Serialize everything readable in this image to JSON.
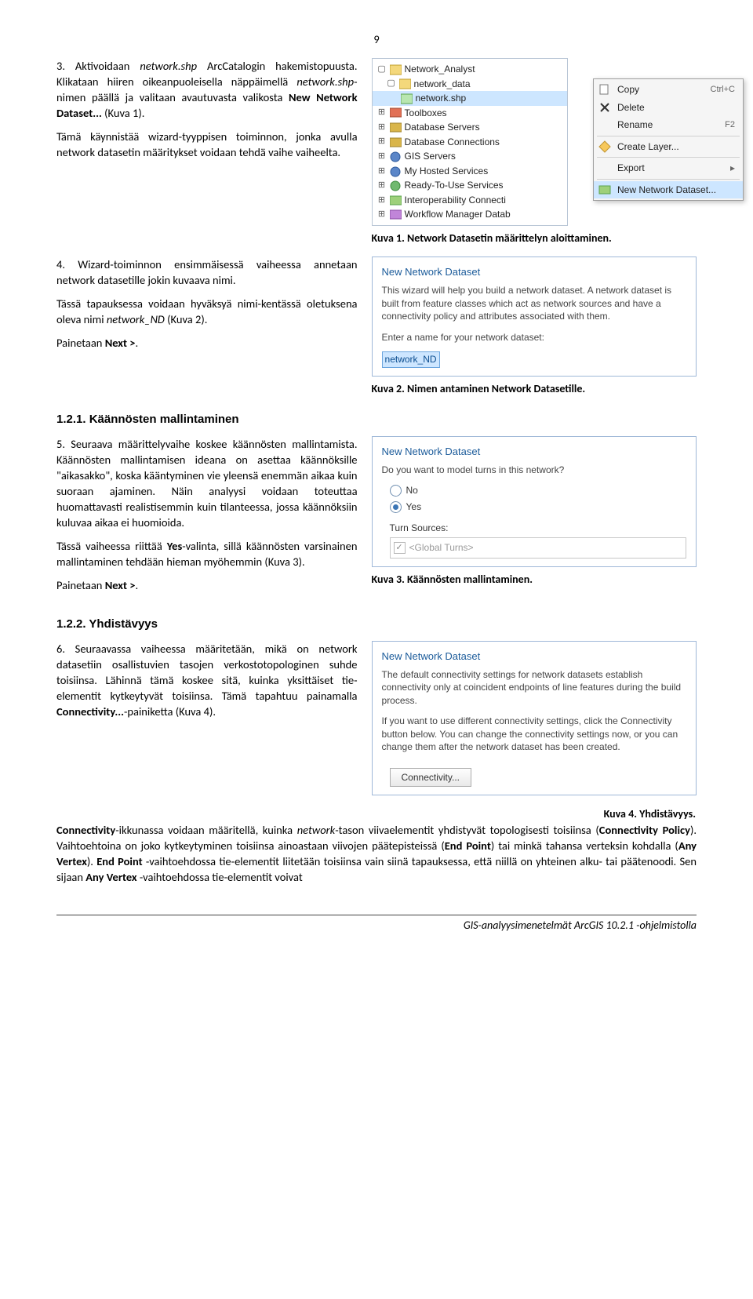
{
  "page_number": "9",
  "section1": {
    "p1_pre": "3. Aktivoidaan ",
    "p1_i": "network.shp",
    "p1_mid1": " ArcCatalogin hakemistopuusta. Klikataan hiiren oikeanpuoleisella näppäimellä ",
    "p1_i2": "network.shp",
    "p1_mid2": "-nimen päällä ja valitaan avautuvasta valikosta ",
    "p1_b": "New Network Dataset...",
    "p1_post": " (Kuva 1).",
    "p2": "Tämä käynnistää wizard-tyyppisen toiminnon, jonka avulla network datasetin määritykset voidaan tehdä vaihe vaiheelta.",
    "caption": "Kuva 1. Network Datasetin määrittelyn aloittaminen."
  },
  "fig1": {
    "tree": [
      "Network_Analyst",
      "network_data",
      "network.shp",
      "Toolboxes",
      "Database Servers",
      "Database Connections",
      "GIS Servers",
      "My Hosted Services",
      "Ready-To-Use Services",
      "Interoperability Connecti",
      "Workflow Manager Datab"
    ],
    "menu_copy": "Copy",
    "kb_copy": "Ctrl+C",
    "menu_delete": "Delete",
    "menu_rename": "Rename",
    "kb_rename": "F2",
    "menu_create": "Create Layer...",
    "menu_export": "Export",
    "menu_nnd": "New Network Dataset..."
  },
  "section2": {
    "p1": "4. Wizard-toiminnon ensimmäisessä vaiheessa annetaan network datasetille jokin kuvaava nimi.",
    "p2_pre": "Tässä tapauksessa voidaan hyväksyä nimi-kentässä oletuksena oleva nimi ",
    "p2_i": "network_ND",
    "p2_post": " (Kuva 2).",
    "p3_pre": "Painetaan ",
    "p3_b": "Next >",
    "p3_post": ".",
    "caption": "Kuva 2. Nimen antaminen Network Datasetille."
  },
  "fig2": {
    "title": "New Network Dataset",
    "txt": "This wizard will help you build a network dataset. A network dataset is built from feature classes which act as network sources and have a connectivity policy and attributes associated with them.",
    "label": "Enter a name for your network dataset:",
    "value": "network_ND"
  },
  "h121": "1.2.1. Käännösten mallintaminen",
  "section3": {
    "p1": "5. Seuraava määrittelyvaihe koskee käännösten mallintamista. Käännösten mallintamisen ideana on asettaa käännöksille \"aikasakko\", koska kääntyminen vie yleensä enemmän aikaa kuin suoraan ajaminen. Näin analyysi voidaan toteuttaa huomattavasti realistisemmin kuin tilanteessa, jossa käännöksiin kuluvaa aikaa ei huomioida.",
    "p2_pre": "Tässä vaiheessa riittää ",
    "p2_b": "Yes",
    "p2_post": "-valinta, sillä käännösten varsinainen mallintaminen tehdään hieman myöhemmin (Kuva 3).",
    "p3_pre": "Painetaan ",
    "p3_b": "Next >",
    "p3_post": ".",
    "caption": "Kuva 3. Käännösten mallintaminen."
  },
  "fig3": {
    "title": "New Network Dataset",
    "txt": "Do you want to model turns in this network?",
    "no": "No",
    "yes": "Yes",
    "tslabel": "Turn Sources:",
    "gt": "<Global Turns>"
  },
  "h122": "1.2.2. Yhdistävyys",
  "section4": {
    "p1_pre": "6. Seuraavassa vaiheessa määritetään, mikä on network datasetiin osallistuvien tasojen verkostotopologinen suhde toisiinsa. Lähinnä tämä koskee sitä, kuinka yksittäiset tie-elementit kytkeytyvät toisiinsa. Tämä tapahtuu painamalla ",
    "p1_b": "Connectivity...",
    "p1_post": "-painiketta (Kuva 4).",
    "caption": "Kuva 4. Yhdistävyys."
  },
  "fig4": {
    "title": "New Network Dataset",
    "txt1": "The default connectivity settings for network datasets establish connectivity only at coincident endpoints of line features during the build process.",
    "txt2": "If you want to use different connectivity settings, click the Connectivity button below. You can change the connectivity settings now, or you can change them after the network dataset has been created.",
    "btn": "Connectivity..."
  },
  "last": {
    "p_1": "Connectivity",
    "p_2": "-ikkunassa voidaan määritellä, kuinka ",
    "p_3": "network",
    "p_4": "-tason viivaelementit yhdistyvät topologisesti toisiinsa (",
    "p_5": "Connectivity Policy",
    "p_6": "). Vaihtoehtoina on joko kytkeytyminen toisiinsa ainoastaan viivojen päätepisteissä (",
    "p_7": "End Point",
    "p_8": ") tai minkä tahansa verteksin kohdalla (",
    "p_9": "Any Vertex",
    "p_10": "). ",
    "p_11": "End Point",
    "p_12": " -vaihtoehdossa tie-elementit liitetään toisiinsa vain siinä tapauksessa, että niillä on yhteinen alku- tai päätenoodi. Sen sijaan ",
    "p_13": "Any Vertex",
    "p_14": " -vaihtoehdossa tie-elementit voivat"
  },
  "footer": "GIS-analyysimenetelmät ArcGIS 10.2.1 -ohjelmistolla"
}
